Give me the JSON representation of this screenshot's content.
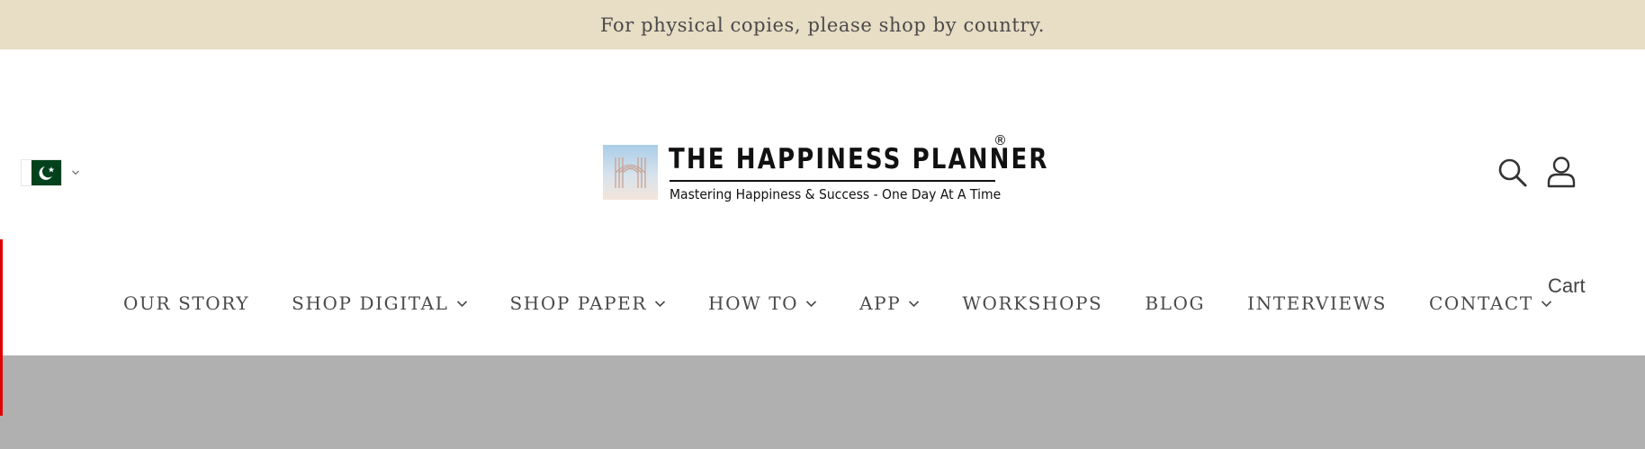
{
  "announcement": {
    "text": "For physical copies, please shop by country."
  },
  "country_selector": {
    "flag": "pakistan-flag-icon",
    "chevron": "chevron-down-icon"
  },
  "logo": {
    "title": "THE HAPPINESS PLANNER",
    "registered": "®",
    "tagline": "Mastering Happiness & Success - One Day At A Time"
  },
  "header_icons": {
    "search": "search-icon",
    "account": "user-icon"
  },
  "cart": {
    "label": "Cart"
  },
  "nav": {
    "items": [
      {
        "label": "OUR STORY",
        "has_dropdown": false
      },
      {
        "label": "SHOP DIGITAL",
        "has_dropdown": true
      },
      {
        "label": "SHOP PAPER",
        "has_dropdown": true
      },
      {
        "label": "HOW TO",
        "has_dropdown": true
      },
      {
        "label": "APP",
        "has_dropdown": true
      },
      {
        "label": "WORKSHOPS",
        "has_dropdown": false
      },
      {
        "label": "BLOG",
        "has_dropdown": false
      },
      {
        "label": "INTERVIEWS",
        "has_dropdown": false
      },
      {
        "label": "CONTACT",
        "has_dropdown": true
      }
    ]
  },
  "colors": {
    "announcement_bg": "#e8ddc5",
    "text": "#4a4a4a",
    "hero_bg": "#b0b0b0",
    "accent_edge": "#e00000",
    "flag_green": "#01411c"
  }
}
